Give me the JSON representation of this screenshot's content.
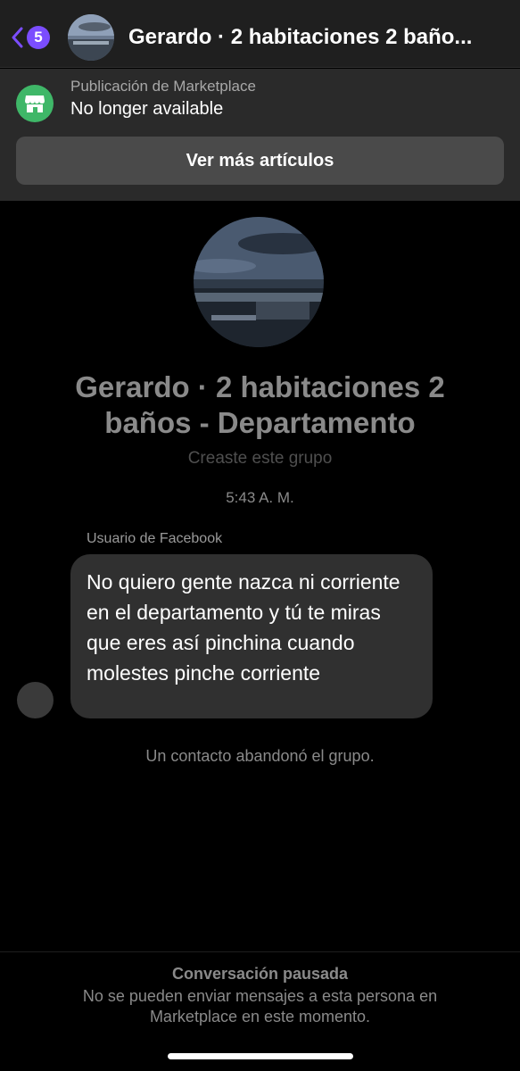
{
  "header": {
    "back_count": "5",
    "title": "Gerardo · 2 habitaciones 2 baño..."
  },
  "marketplace": {
    "label": "Publicación de Marketplace",
    "status": "No longer available",
    "button_label": "Ver más artículos",
    "icon": "store-icon",
    "icon_color": "#3fb768"
  },
  "group": {
    "name": "Gerardo · 2 habitaciones 2 baños - Departamento",
    "subtitle": "Creaste este grupo"
  },
  "conversation": {
    "timestamp": "5:43 A. M.",
    "messages": [
      {
        "sender": "Usuario de Facebook",
        "text": "No quiero gente nazca ni corriente en el departamento y tú te miras que eres así pinchina cuando molestes pinche corriente"
      }
    ],
    "system_message": "Un contacto abandonó el grupo."
  },
  "footer": {
    "title": "Conversación pausada",
    "text": "No se pueden enviar mensajes a esta persona en Marketplace en este momento."
  },
  "colors": {
    "accent": "#7b4dff",
    "background": "#000000",
    "bubble": "#303030"
  }
}
